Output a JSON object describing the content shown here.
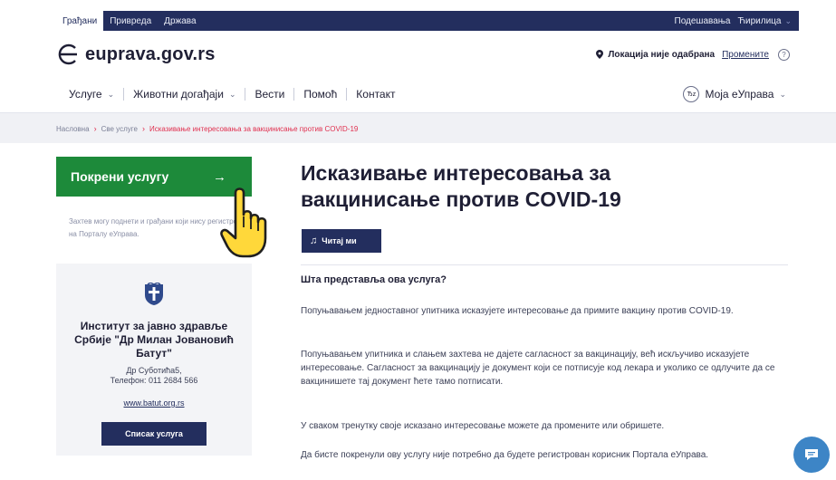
{
  "topbar": {
    "tabs": [
      "Грађани",
      "Привреда",
      "Држава"
    ],
    "settings": "Подешавања",
    "script": "Ћирилица"
  },
  "header": {
    "brand": "euprava.gov.rs",
    "location_status": "Локација није одабрана",
    "change_link": "Промените",
    "help": "?"
  },
  "nav": {
    "items": [
      "Услуге",
      "Животни догађаји",
      "Вести",
      "Помоћ",
      "Контакт"
    ],
    "account": "Моја еУправа",
    "account_icon": "Ђz"
  },
  "breadcrumb": {
    "items": [
      "Насловна",
      "Све услуге",
      "Исказивање интересовања за вакцинисање против COVID-19"
    ],
    "separator": "›"
  },
  "sidebar": {
    "start_button": "Покрени услугу",
    "start_arrow": "→",
    "note": "Захтев могу поднети и грађани који нису регистровани на Порталу еУправа.",
    "institution": {
      "name": "Институт за јавно здравље Србије \"Др Милан Јовановић Батут\"",
      "address": "Др Суботића5,",
      "phone": "Телефон: 011 2684 566",
      "website": "www.batut.org.rs",
      "list_button": "Списак услуга"
    }
  },
  "main": {
    "title": "Исказивање интересовања за вакцинисање против COVID-19",
    "read_button": "Читај ми",
    "question": "Шта представља ова услуга?",
    "paragraphs": [
      "Попуњавањем једноставног упитника исказујете интересовање да примите вакцину против COVID-19.",
      "Попуњавањем упитника и слањем захтева не дајете сагласност за вакцинацију, већ искључиво исказујете интересовање. Сагласност за вакцинацију је документ који се потписује код лекара и уколико се одлучите да се вакцинишете тај документ ћете тамо потписати.",
      "У сваком тренутку своје исказано интересовање можете да промените или обришете.",
      "Да бисте покренули ову услугу није потребно да будете регистрован корисник Портала еУправа."
    ]
  },
  "colors": {
    "navy": "#232e5e",
    "green": "#1d8a3a",
    "crumb_red": "#e0304f",
    "chat_blue": "#3d85c6"
  },
  "icons": [
    "logo-e-icon",
    "location-pin-icon",
    "help-icon",
    "account-icon",
    "arrow-right-icon",
    "pointing-hand-icon",
    "institution-crest-icon",
    "read-aloud-icon",
    "chat-icon"
  ]
}
